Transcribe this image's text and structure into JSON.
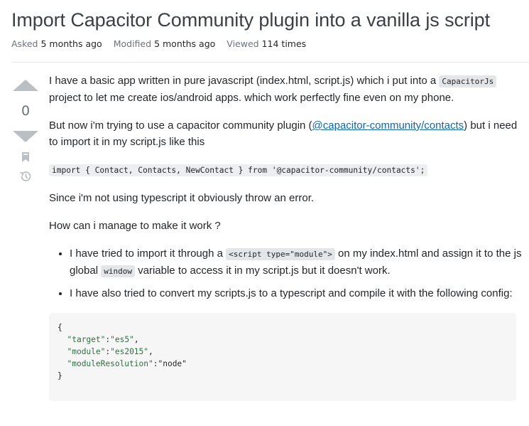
{
  "question": {
    "title": "Import Capacitor Community plugin into a vanilla js script",
    "meta": {
      "asked_label": "Asked",
      "asked_value": "5 months ago",
      "modified_label": "Modified",
      "modified_value": "5 months ago",
      "viewed_label": "Viewed",
      "viewed_value": "114 times"
    },
    "score": "0"
  },
  "body": {
    "p1_a": "I have a basic app written in pure javascript (index.html, script.js) which i put into a ",
    "p1_code": "CapacitorJs",
    "p1_b": " project to let me create ios/android apps. which work perfectly fine even on my phone.",
    "p2_a": "But now i'm trying to use a capacitor community plugin (",
    "p2_link": "@capacitor-community/contacts",
    "p2_b": ") but i need to import it in my script.js like this",
    "import_code": "import { Contact, Contacts, NewContact } from '@capacitor-community/contacts';",
    "p3": "Since i'm not using typescript it obviously throw an error.",
    "p4": "How can i manage to make it work ?",
    "li1_a": "I have tried to import it through a ",
    "li1_code1": "<script type=\"module\">",
    "li1_b": " on my index.html and assign it to the js global ",
    "li1_code2": "window",
    "li1_c": " variable to access it in my script.js but it doesn't work.",
    "li2": "I have also tried to convert my scripts.js to a typescript and compile it with the following config:",
    "config": {
      "open": "{",
      "k1": "\"target\"",
      "v1": "\"es5\"",
      "k2": "\"module\"",
      "v2": "\"es2015\"",
      "k3": "\"moduleResolution\"",
      "v3": "\"node\"",
      "close": "}"
    }
  },
  "icons": {
    "upvote": "upvote-arrow-icon",
    "downvote": "downvote-arrow-icon",
    "bookmark": "bookmark-icon",
    "history": "history-icon"
  },
  "colors": {
    "link": "#0c65b7",
    "vote_arrow": "#babfc4",
    "code_bg": "#e3e6e8",
    "codeblock_bg": "#f6f6f6"
  }
}
